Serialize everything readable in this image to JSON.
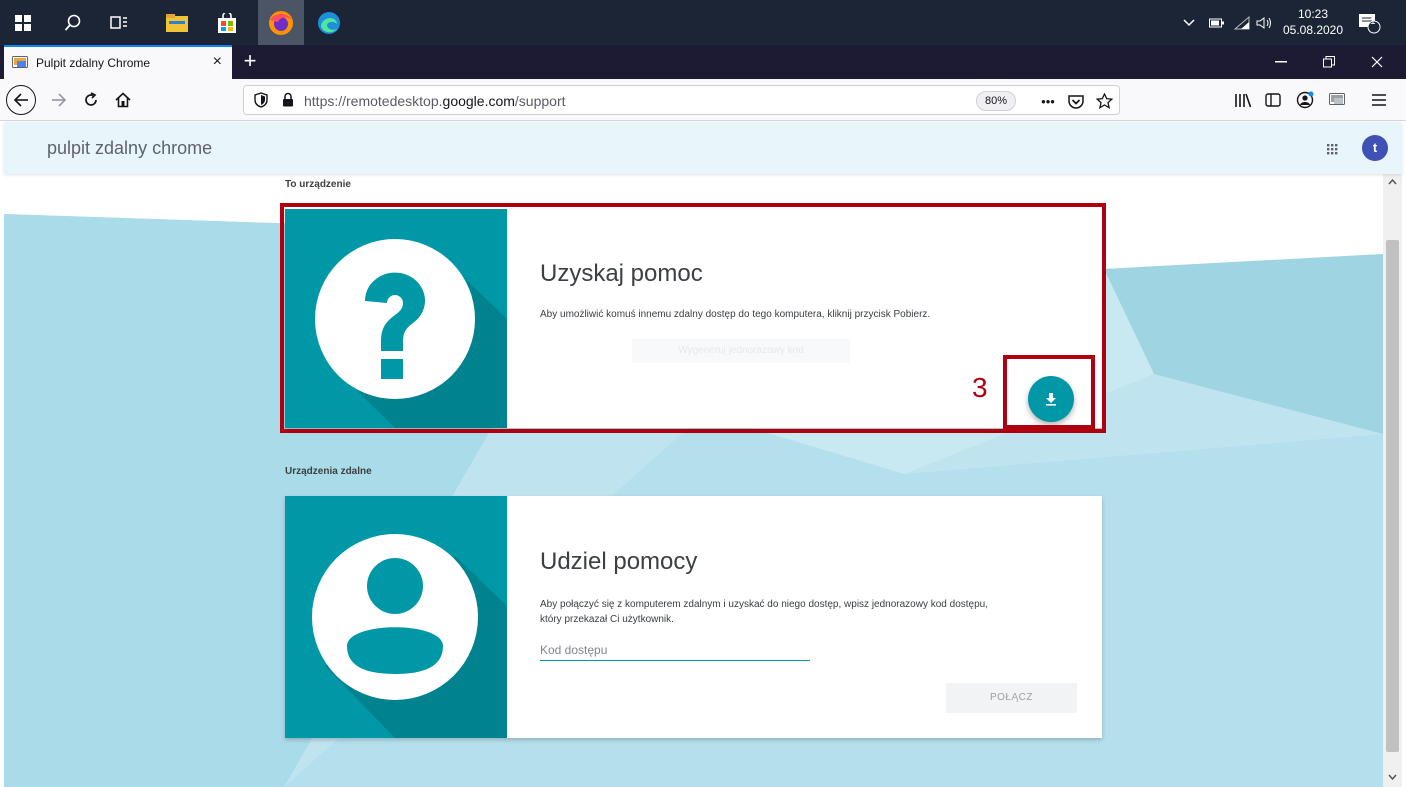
{
  "taskbar": {
    "clock_time": "10:23",
    "clock_date": "05.08.2020",
    "notification_count": "1"
  },
  "tab": {
    "title": "Pulpit zdalny Chrome",
    "close": "×",
    "new_tab": "+"
  },
  "navbar": {
    "url_prefix": "https://remotedesktop.",
    "url_domain": "google.com",
    "url_path": "/support",
    "zoom": "80%",
    "more": "•••"
  },
  "header": {
    "brand": "pulpit zdalny chrome",
    "avatar_initial": "t"
  },
  "this_device": {
    "section_label": "To urządzenie",
    "title": "Uzyskaj pomoc",
    "description": "Aby umożliwić komuś innemu zdalny dostęp do tego komputera, kliknij przycisk Pobierz.",
    "faded_button": "Wygeneruj jednorazowy kod"
  },
  "remote_devices": {
    "section_label": "Urządzenia zdalne",
    "title": "Udziel pomocy",
    "description_line1": "Aby połączyć się z komputerem zdalnym i uzyskać do niego dostęp, wpisz jednorazowy kod dostępu,",
    "description_line2": "który przekazał Ci użytkownik.",
    "code_placeholder": "Kod dostępu",
    "connect_label": "POŁĄCZ"
  },
  "annotation": {
    "step_number": "3",
    "color": "#b00010"
  },
  "colors": {
    "teal": "#0097a7",
    "page_bg": "#bfe4ef"
  }
}
